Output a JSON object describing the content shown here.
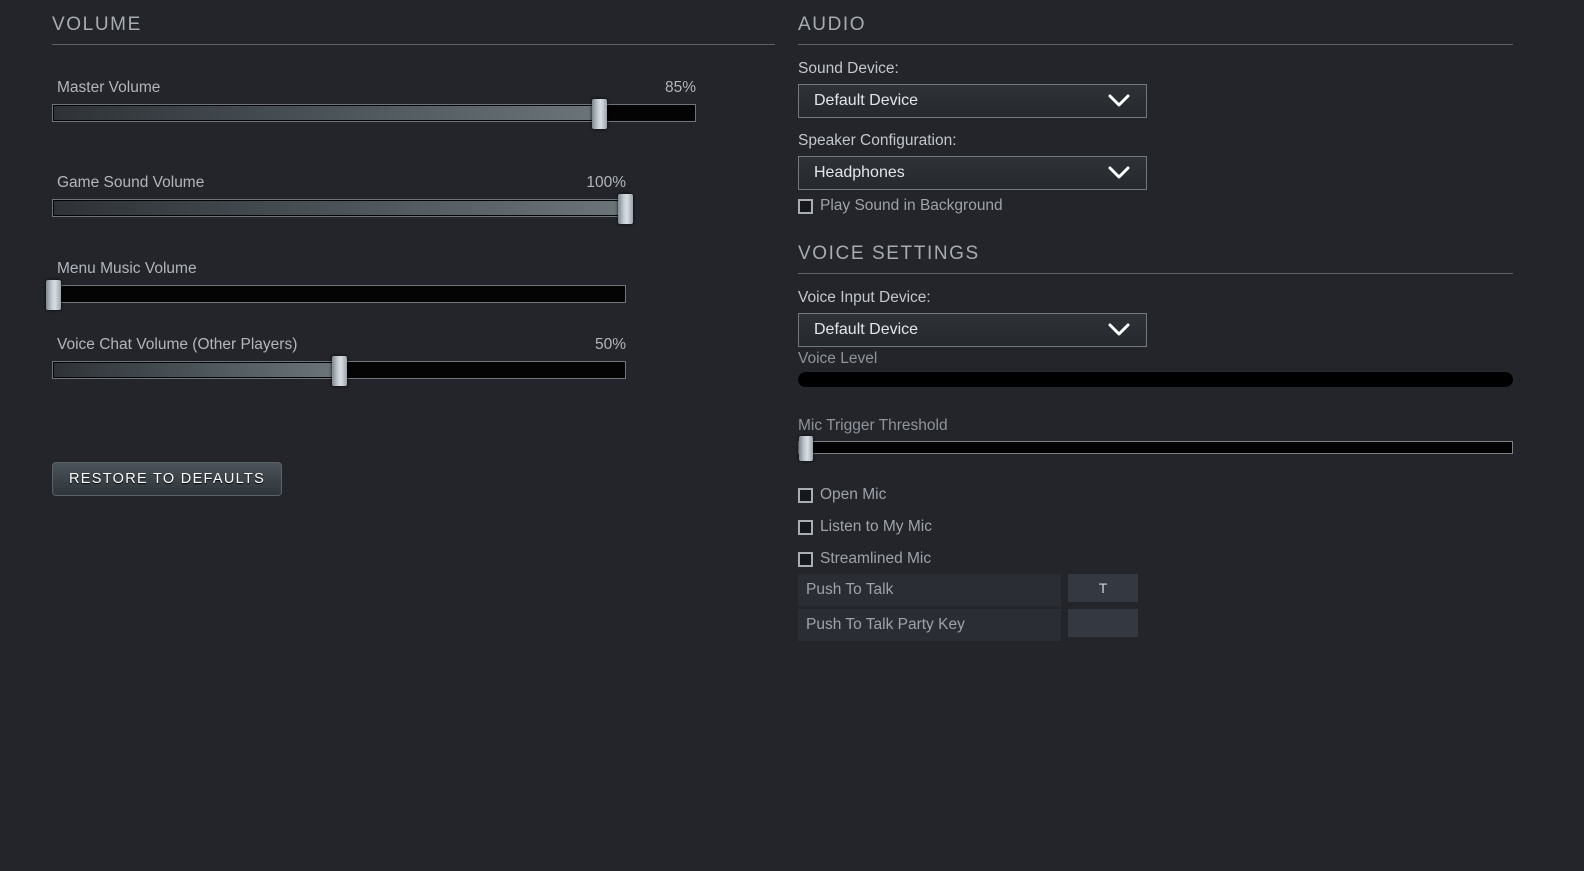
{
  "volume": {
    "section_title": "VOLUME",
    "sliders": [
      {
        "label": "Master Volume",
        "value_text": "85%",
        "percent": 85,
        "track_width": 644,
        "show_value": true
      },
      {
        "label": "Game Sound Volume",
        "value_text": "100%",
        "percent": 100,
        "track_width": 574,
        "show_value": true
      },
      {
        "label": "Menu Music Volume",
        "value_text": "",
        "percent": 0,
        "track_width": 574,
        "show_value": false
      },
      {
        "label": "Voice Chat Volume (Other Players)",
        "value_text": "50%",
        "percent": 50,
        "track_width": 574,
        "show_value": true
      }
    ],
    "restore_button": "Restore to Defaults"
  },
  "audio": {
    "section_title": "AUDIO",
    "sound_device_label": "Sound Device:",
    "sound_device_value": "Default Device",
    "speaker_config_label": "Speaker Configuration:",
    "speaker_config_value": "Headphones",
    "play_in_background_label": "Play Sound in Background",
    "play_in_background_checked": false
  },
  "voice_settings": {
    "section_title": "VOICE SETTINGS",
    "input_device_label": "Voice Input Device:",
    "input_device_value": "Default Device",
    "voice_level_label": "Voice Level",
    "voice_level_percent": 0,
    "mic_threshold_label": "Mic Trigger Threshold",
    "mic_threshold_percent": 0,
    "checkboxes": [
      {
        "label": "Open Mic",
        "checked": false
      },
      {
        "label": "Listen to My Mic",
        "checked": false
      },
      {
        "label": "Streamlined Mic",
        "checked": false
      }
    ],
    "bindings": [
      {
        "name": "Push To Talk",
        "key": "T"
      },
      {
        "name": "Push To Talk Party Key",
        "key": ""
      }
    ]
  },
  "colors": {
    "background": "#23252b",
    "text": "#b9bcc2",
    "dim_text": "#8f949a",
    "rule": "#8e9399",
    "knob": "#cdd4da"
  }
}
